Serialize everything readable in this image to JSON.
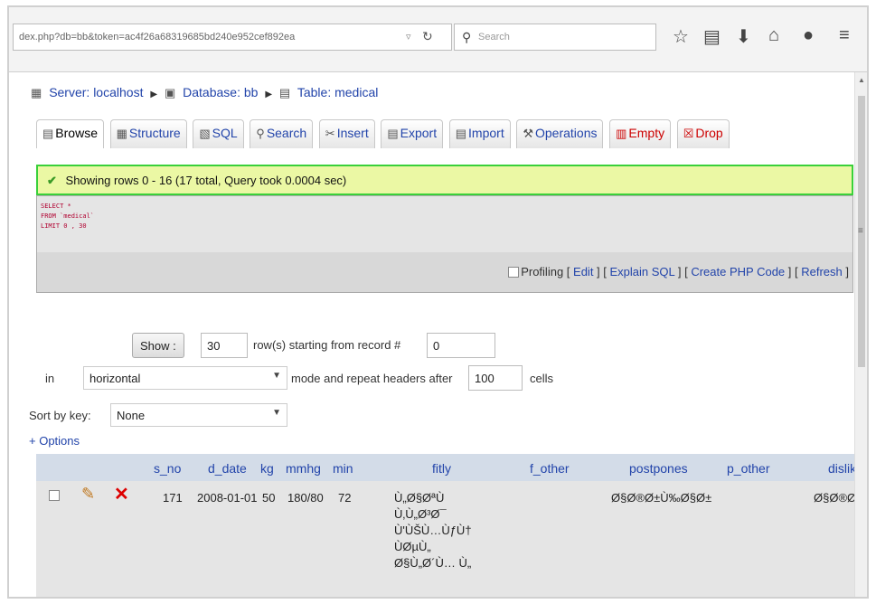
{
  "browser": {
    "url": "dex.php?db=bb&token=ac4f26a68319685bd240e952cef892ea",
    "search_placeholder": "Search"
  },
  "breadcrumb": {
    "server": "Server: localhost",
    "database": "Database: bb",
    "table": "Table: medical"
  },
  "tabs": [
    {
      "label": "Browse",
      "icon": "browse-icon"
    },
    {
      "label": "Structure",
      "icon": "structure-icon"
    },
    {
      "label": "SQL",
      "icon": "sql-icon"
    },
    {
      "label": "Search",
      "icon": "search-icon"
    },
    {
      "label": "Insert",
      "icon": "insert-icon"
    },
    {
      "label": "Export",
      "icon": "export-icon"
    },
    {
      "label": "Import",
      "icon": "import-icon"
    },
    {
      "label": "Operations",
      "icon": "operations-icon"
    },
    {
      "label": "Empty",
      "icon": "empty-icon"
    },
    {
      "label": "Drop",
      "icon": "drop-icon"
    }
  ],
  "success_message": "Showing rows 0 - 16 (17 total, Query took 0.0004 sec)",
  "sql_query": {
    "line1": "SELECT *",
    "line2": "FROM `medical`",
    "line3": "LIMIT 0 , 30"
  },
  "sql_links": {
    "profiling": "Profiling",
    "edit": "Edit",
    "explain": "Explain SQL",
    "create_php": "Create PHP Code",
    "refresh": "Refresh"
  },
  "navigation_form": {
    "show_button": "Show :",
    "rows_value": "30",
    "starting_label": "row(s) starting from record #",
    "start_value": "0",
    "in_label": "in",
    "mode_value": "horizontal",
    "mode_label": "mode and repeat headers after",
    "repeat_value": "100",
    "cells_label": "cells",
    "sort_label": "Sort by key:",
    "sort_value": "None",
    "options_link": "+ Options"
  },
  "table": {
    "columns": [
      "s_no",
      "d_date",
      "kg",
      "mmhg",
      "min",
      "fitly",
      "f_other",
      "postpones",
      "p_other",
      "dislik"
    ],
    "rows": [
      {
        "s_no": "171",
        "d_date": "2008-01-01",
        "kg": "50",
        "mmhg": "180/80",
        "min": "72",
        "fitly_lines": [
          "Ù„Ø§ØªÙ",
          "Ù‚Ù„Ø³Ø¯",
          "Ù'ÙŠÙ…ÙƒÙ†",
          "ÙØµÙ„",
          "Ø§Ù„Ø´Ù…  Ù„"
        ],
        "f_other": "",
        "postpones": "Ø§Ø®Ø±Ù‰Ø§Ø±",
        "p_other": "",
        "dislik": "Ø§Ø®Ø±Ù‰"
      }
    ]
  }
}
